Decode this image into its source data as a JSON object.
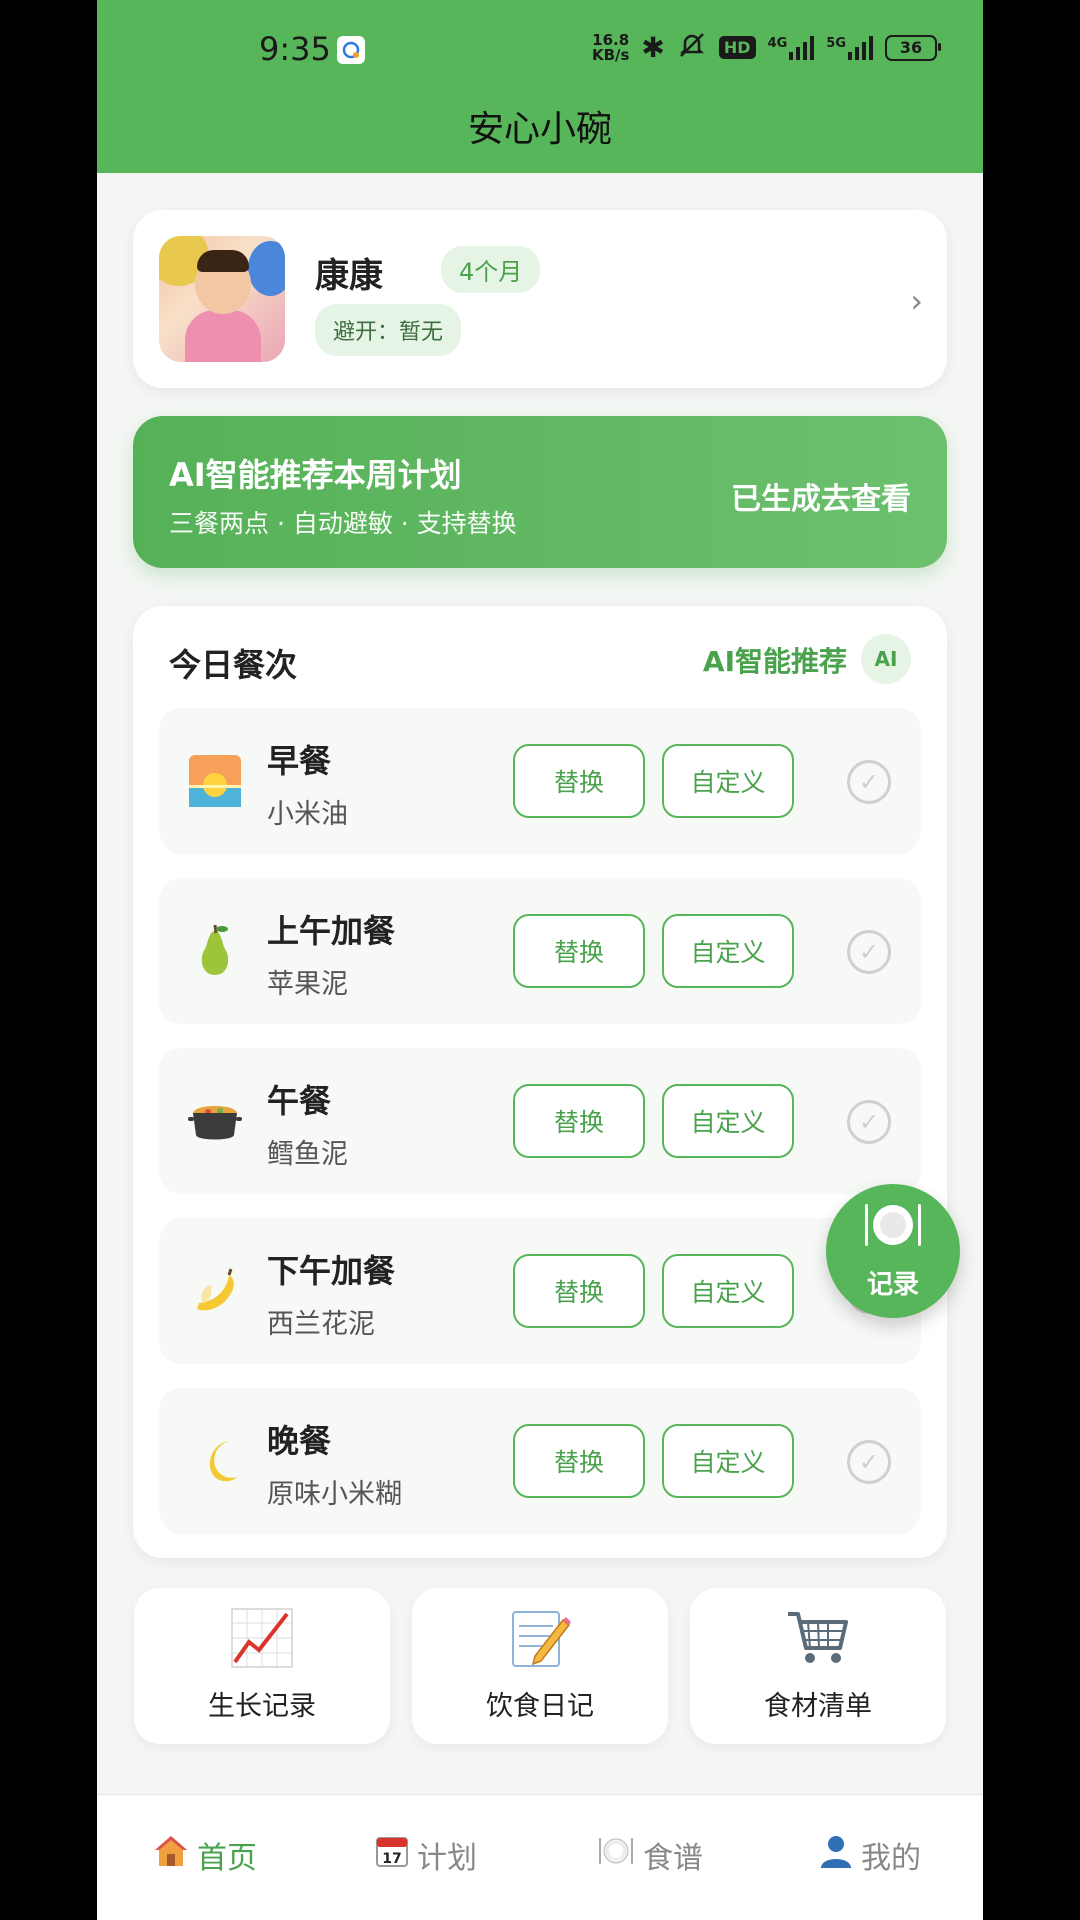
{
  "status_bar": {
    "time": "9:35",
    "speed_value": "16.8",
    "speed_unit": "KB/s",
    "hd": "HD",
    "net1": "4G",
    "net2": "5G",
    "battery": "36"
  },
  "header": {
    "title": "安心小碗"
  },
  "profile": {
    "name": "康康",
    "age": "4个月",
    "avoid": "避开：暂无"
  },
  "ai_banner": {
    "title": "AI智能推荐本周计划",
    "subtitle": "三餐两点 · 自动避敏 · 支持替换",
    "action": "已生成去查看"
  },
  "meals": {
    "title": "今日餐次",
    "ai_label": "AI智能推荐",
    "ai_badge": "AI",
    "replace_label": "替换",
    "custom_label": "自定义",
    "items": [
      {
        "name": "早餐",
        "food": "小米油",
        "icon": "sunrise-icon"
      },
      {
        "name": "上午加餐",
        "food": "苹果泥",
        "icon": "pear-icon"
      },
      {
        "name": "午餐",
        "food": "鳕鱼泥",
        "icon": "pot-icon"
      },
      {
        "name": "下午加餐",
        "food": "西兰花泥",
        "icon": "banana-icon"
      },
      {
        "name": "晚餐",
        "food": "原味小米糊",
        "icon": "moon-icon"
      }
    ]
  },
  "fab": {
    "label": "记录",
    "icon": "plate-icon"
  },
  "quick": [
    {
      "label": "生长记录",
      "icon": "chart-icon"
    },
    {
      "label": "饮食日记",
      "icon": "memo-icon"
    },
    {
      "label": "食材清单",
      "icon": "cart-icon"
    }
  ],
  "bottom_nav": [
    {
      "label": "首页",
      "icon": "home-icon",
      "active": true
    },
    {
      "label": "计划",
      "icon": "calendar-icon",
      "active": false
    },
    {
      "label": "食谱",
      "icon": "plate-icon",
      "active": false
    },
    {
      "label": "我的",
      "icon": "person-icon",
      "active": false
    }
  ],
  "colors": {
    "primary": "#57b55a",
    "accent_text": "#4aa24d",
    "light_green": "#e6f4e6"
  }
}
